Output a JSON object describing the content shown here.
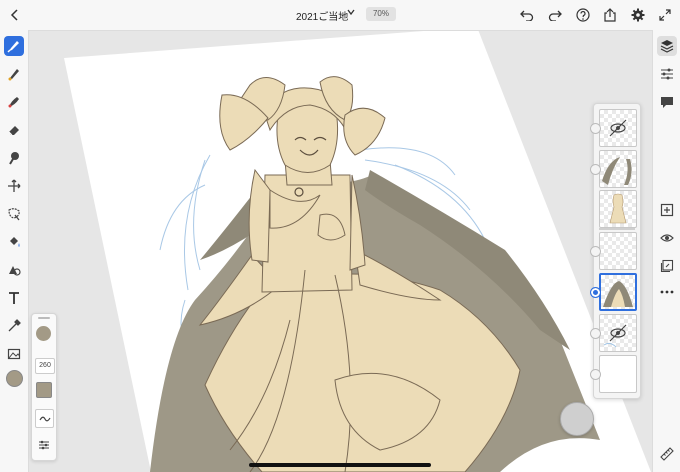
{
  "document": {
    "title": "2021ご当地",
    "zoom": "70%"
  },
  "top_icons": [
    "back-icon",
    "undo-icon",
    "redo-icon",
    "help-icon",
    "share-icon",
    "settings-icon",
    "fullscreen-icon"
  ],
  "left_tools": [
    "pixel-brush-icon",
    "live-brush-icon",
    "vector-brush-icon",
    "eraser-icon",
    "smudge-icon",
    "transform-icon",
    "selection-icon",
    "fill-icon",
    "shape-icon",
    "text-icon",
    "eyedropper-icon",
    "image-icon",
    "color-swatch"
  ],
  "brush_panel": {
    "size": "260",
    "color": "#a39a86"
  },
  "right_tools": [
    "layers-icon",
    "properties-icon",
    "comments-icon",
    "add-layer-icon",
    "visibility-icon",
    "import-icon",
    "more-icon",
    "ruler-icon"
  ],
  "layers": [
    {
      "name": "hidden-sketch",
      "hidden": true
    },
    {
      "name": "hair-shadow",
      "hidden": false
    },
    {
      "name": "figure-lineart",
      "hidden": false
    },
    {
      "name": "empty-layer",
      "hidden": false
    },
    {
      "name": "base-fill",
      "hidden": false,
      "selected": true
    },
    {
      "name": "hidden-guides",
      "hidden": true
    },
    {
      "name": "background",
      "hidden": false
    }
  ],
  "colors": {
    "accent": "#2f6fde",
    "skin": "#ecdcb7",
    "shadow": "#9e9887",
    "line": "#7a6a55",
    "sketch": "#9fc3e4"
  }
}
